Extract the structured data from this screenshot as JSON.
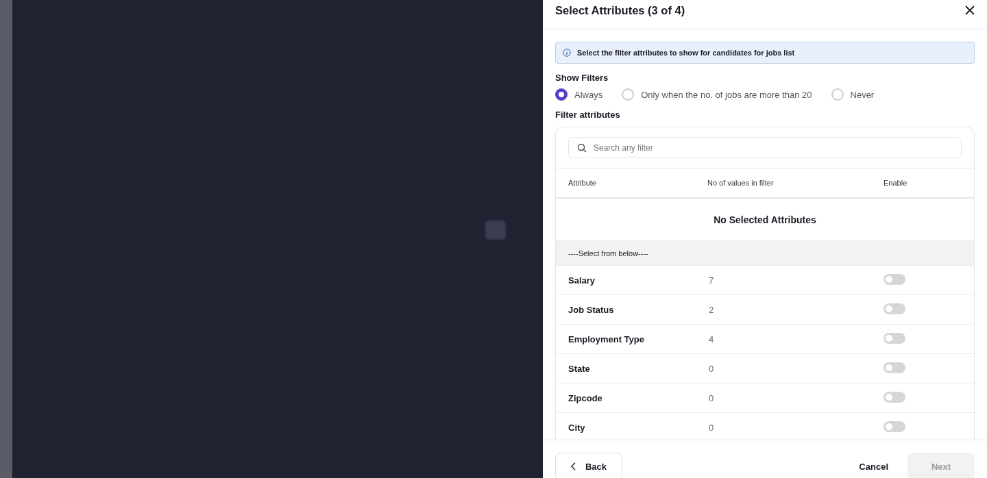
{
  "dialog": {
    "title": "Select Attributes (3 of 4)",
    "info_banner": "Select the filter attributes to show for candidates for jobs list",
    "show_filters": {
      "label": "Show Filters",
      "options": [
        {
          "label": "Always",
          "selected": true
        },
        {
          "label": "Only when the no. of jobs are more than 20",
          "selected": false
        },
        {
          "label": "Never",
          "selected": false
        }
      ]
    },
    "filter_attributes": {
      "label": "Filter attributes",
      "search": {
        "placeholder": "Search any filter"
      },
      "columns": [
        "Attribute",
        "No of values in filter",
        "Enable"
      ],
      "empty_message": "No Selected Attributes",
      "section_label": "----Select from below----",
      "rows": [
        {
          "attribute": "Salary",
          "count": "7",
          "enabled": false
        },
        {
          "attribute": "Job Status",
          "count": "2",
          "enabled": false
        },
        {
          "attribute": "Employment Type",
          "count": "4",
          "enabled": false
        },
        {
          "attribute": "State",
          "count": "0",
          "enabled": false
        },
        {
          "attribute": "Zipcode",
          "count": "0",
          "enabled": false
        },
        {
          "attribute": "City",
          "count": "0",
          "enabled": false
        }
      ]
    },
    "footer": {
      "back": "Back",
      "cancel": "Cancel",
      "next": {
        "label": "Next",
        "disabled": true
      }
    }
  }
}
